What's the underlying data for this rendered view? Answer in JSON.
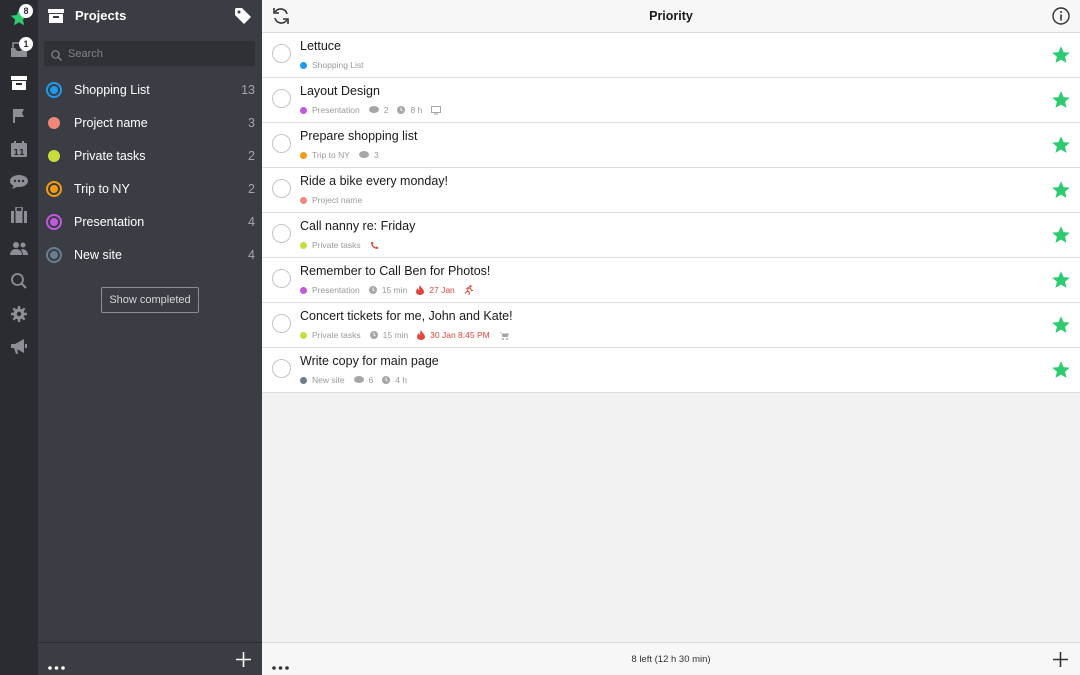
{
  "rail": {
    "favorites_badge": "8",
    "inbox_badge": "1",
    "accent_color": "#2ecc71",
    "icons": [
      "star-icon",
      "inbox-icon",
      "projects-icon",
      "flag-icon",
      "calendar-icon",
      "chat-icon",
      "briefcase-icon",
      "people-icon",
      "search-icon",
      "gear-icon",
      "megaphone-icon"
    ],
    "calendar_day": "11"
  },
  "sidebar": {
    "title": "Projects",
    "search_placeholder": "Search",
    "projects": [
      {
        "name": "Shopping List",
        "count": "13",
        "color": "#1e9bef"
      },
      {
        "name": "Project name",
        "count": "3",
        "color": "#f0877a"
      },
      {
        "name": "Private tasks",
        "count": "2",
        "color": "#c8dc3c"
      },
      {
        "name": "Trip to NY",
        "count": "2",
        "color": "#f39c12"
      },
      {
        "name": "Presentation",
        "count": "4",
        "color": "#c257e0"
      },
      {
        "name": "New site",
        "count": "4",
        "color": "#6b7d8f"
      }
    ],
    "show_completed_label": "Show completed"
  },
  "main": {
    "title": "Priority",
    "tasks": [
      {
        "title": "Lettuce",
        "project": "Shopping List",
        "project_color": "#1e9bef"
      },
      {
        "title": "Layout Design",
        "project": "Presentation",
        "project_color": "#c257e0",
        "comments": "2",
        "duration": "8 h",
        "device": "monitor-icon"
      },
      {
        "title": "Prepare shopping list",
        "project": "Trip to NY",
        "project_color": "#f39c12",
        "comments": "3"
      },
      {
        "title": "Ride a bike every monday!",
        "project": "Project name",
        "project_color": "#f0877a"
      },
      {
        "title": "Call nanny re: Friday",
        "project": "Private tasks",
        "project_color": "#c8dc3c",
        "context": "phone-icon"
      },
      {
        "title": "Remember to Call Ben for Photos!",
        "project": "Presentation",
        "project_color": "#c257e0",
        "duration": "15 min",
        "due": "27 Jan",
        "context": "running-icon"
      },
      {
        "title": "Concert tickets for me, John and Kate!",
        "project": "Private tasks",
        "project_color": "#c8dc3c",
        "duration": "15 min",
        "due": "30 Jan 8:45 PM",
        "context": "cart-icon"
      },
      {
        "title": "Write copy for main page",
        "project": "New site",
        "project_color": "#6b7d8f",
        "comments": "6",
        "duration": "4 h"
      }
    ],
    "status": "8 left (12 h 30 min)",
    "star_color": "#2ecc71",
    "overdue_color": "#e0463a"
  }
}
